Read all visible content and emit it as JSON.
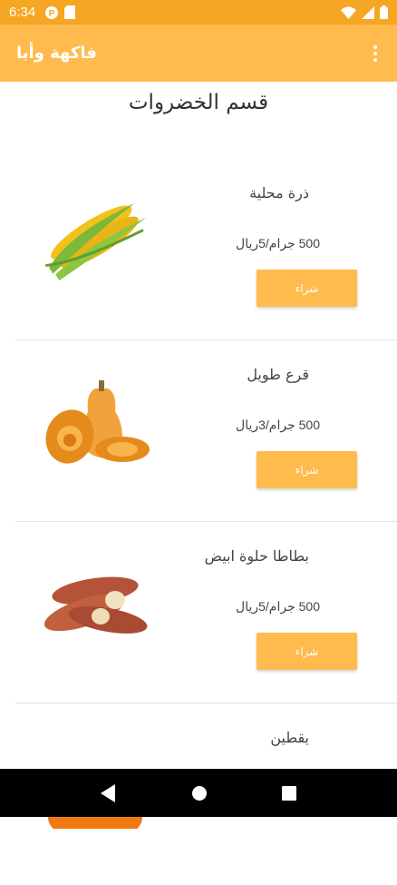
{
  "status_bar": {
    "time": "6:34"
  },
  "app_bar": {
    "title": "فاكهة وأبا"
  },
  "section_title": "قسم الخضروات",
  "products": [
    {
      "name": "ذرة محلية",
      "price": "500 جرام/5ريال",
      "buy_label": "شراء",
      "image_icon": "corn-image"
    },
    {
      "name": "قرع طويل",
      "price": "500 جرام/3ريال",
      "buy_label": "شراء",
      "image_icon": "butternut-squash-image"
    },
    {
      "name": "بطاطا حلوة ابيض",
      "price": "500 جرام/5ريال",
      "buy_label": "شراء",
      "image_icon": "sweet-potato-image"
    },
    {
      "name": "يقطين",
      "price": "",
      "buy_label": "",
      "image_icon": "pumpkin-image"
    }
  ],
  "colors": {
    "status_bar": "#F5A623",
    "app_bar": "#FFBB4D",
    "button": "#FFBB4D"
  }
}
